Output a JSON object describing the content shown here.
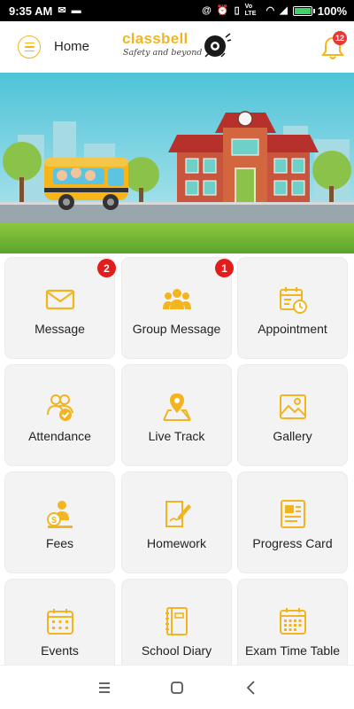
{
  "status_bar": {
    "time": "9:35 AM",
    "battery": "100%",
    "network": "Vo LTE"
  },
  "header": {
    "title": "Home",
    "logo_text": "classbell",
    "logo_tagline": "Safety and beyond",
    "notification_count": "12",
    "accent_color": "#f3b51f"
  },
  "tiles": [
    {
      "label": "Message",
      "icon": "envelope-icon",
      "badge": "2"
    },
    {
      "label": "Group Message",
      "icon": "group-icon",
      "badge": "1"
    },
    {
      "label": "Appointment",
      "icon": "calendar-clock-icon"
    },
    {
      "label": "Attendance",
      "icon": "attendance-icon"
    },
    {
      "label": "Live Track",
      "icon": "map-pin-icon"
    },
    {
      "label": "Gallery",
      "icon": "image-icon"
    },
    {
      "label": "Fees",
      "icon": "fees-icon"
    },
    {
      "label": "Homework",
      "icon": "homework-icon"
    },
    {
      "label": "Progress Card",
      "icon": "report-card-icon"
    },
    {
      "label": "Events",
      "icon": "calendar-icon"
    },
    {
      "label": "School Diary",
      "icon": "diary-icon"
    },
    {
      "label": "Exam Time Table",
      "icon": "timetable-icon"
    }
  ],
  "nav": {
    "items": [
      "recent-apps-icon",
      "home-icon",
      "back-icon"
    ]
  }
}
